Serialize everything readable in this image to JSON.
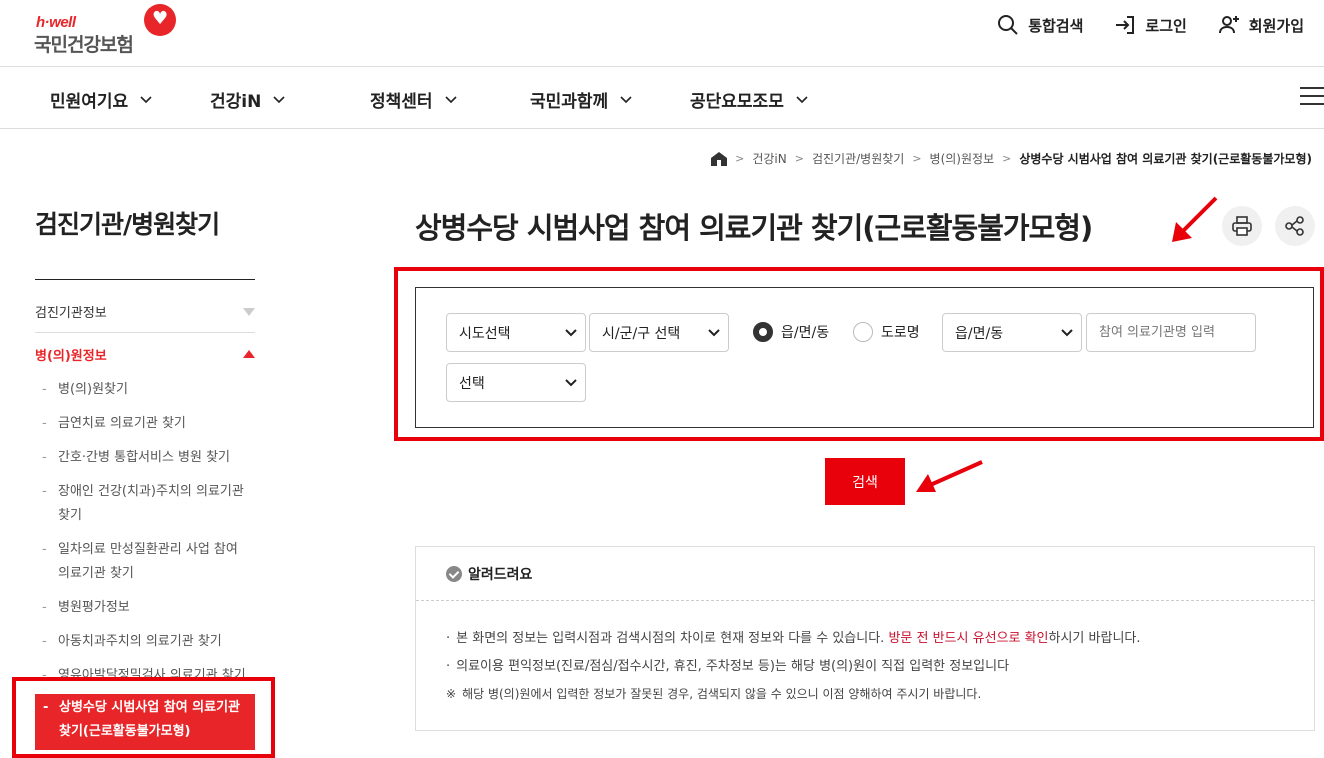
{
  "header": {
    "logo_top": "h·well",
    "logo_main": "국민건강보험",
    "links": {
      "search": "통합검색",
      "login": "로그인",
      "signup": "회원가입"
    }
  },
  "gnb": {
    "items": [
      "민원여기요",
      "건강iN",
      "정책센터",
      "국민과함께",
      "공단요모조모"
    ]
  },
  "breadcrumb": {
    "items": [
      "건강iN",
      "검진기관/병원찾기",
      "병(의)원정보"
    ],
    "current": "상병수당 시범사업 참여 의료기관 찾기(근로활동불가모형)"
  },
  "sidebar": {
    "title": "검진기관/병원찾기",
    "groups": [
      "검진기관정보",
      "병(의)원정보"
    ],
    "subitems": [
      "병(의)원찾기",
      "금연치료 의료기관 찾기",
      "간호·간병 통합서비스 병원 찾기",
      "장애인 건강(치과)주치의 의료기관 찾기",
      "일차의료 만성질환관리 사업 참여 의료기관 찾기",
      "병원평가정보",
      "아동치과주치의 의료기관 찾기",
      "영유아발달정밀검사 의료기관 찾기",
      "상병수당 시범사업 참여 의료기관 찾기(근로활동불가모형)"
    ]
  },
  "main": {
    "title": "상병수당 시범사업 참여 의료기관 찾기(근로활동불가모형)",
    "form": {
      "sido": "시도선택",
      "sigungu": "시/군/구 선택",
      "radio_town": "읍/면/동",
      "radio_road": "도로명",
      "town_select": "읍/면/동",
      "name_placeholder": "참여 의료기관명 입력",
      "type_select": "선택",
      "search_button": "검색"
    },
    "notice": {
      "title": "알려드려요",
      "line1_a": "본 화면의 정보는 입력시점과 검색시점의 차이로 현재 정보와 다를 수 있습니다. ",
      "line1_red": "방문 전 반드시 유선으로 확인",
      "line1_b": "하시기 바랍니다.",
      "line2": "의료이용 편익정보(진료/점심/접수시간, 휴진, 주차정보 등)는 해당 병(의)원이 직접 입력한 정보입니다",
      "line3_mark": "※",
      "line3": "해당 병(의)원에서 입력한 정보가 잘못된 경우, 검색되지 않을 수 있으니 이점 양해하여 주시기 바랍니다."
    }
  },
  "colors": {
    "brand_red": "#e8262a",
    "highlight_red": "#e8000b"
  }
}
